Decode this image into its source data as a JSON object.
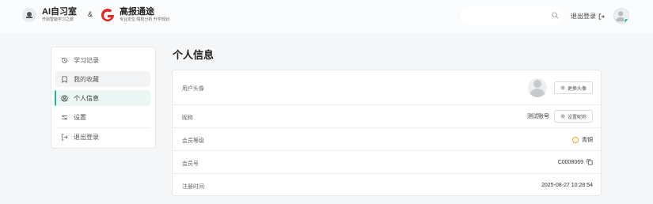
{
  "header": {
    "brand1_title": "AI自习室",
    "brand1_subtitle": "开启智能学习之旅",
    "amp": "&",
    "brand2_title": "高报通途",
    "brand2_subtitle": "专业定位 院校分析 升学规划",
    "logout_label": "退出登录"
  },
  "sidebar": {
    "items": [
      {
        "label": "学习记录",
        "icon": "history-icon"
      },
      {
        "label": "我的收藏",
        "icon": "bookmark-icon"
      },
      {
        "label": "个人信息",
        "icon": "user-circle-icon"
      },
      {
        "label": "设置",
        "icon": "settings-sliders-icon"
      },
      {
        "label": "退出登录",
        "icon": "logout-icon"
      }
    ]
  },
  "main": {
    "title": "个人信息",
    "rows": {
      "avatar": {
        "label": "用户头像",
        "button": "更换头像"
      },
      "nickname": {
        "label": "昵称",
        "value": "测试账号",
        "button": "设置昵称"
      },
      "level": {
        "label": "会员等级",
        "value": "青铜"
      },
      "member_id": {
        "label": "会员号",
        "value": "C0008069"
      },
      "registered": {
        "label": "注册时间",
        "value": "2025-08-27 10:28:54"
      }
    }
  },
  "colors": {
    "accent": "#22b8a3",
    "brand_red": "#e8251f",
    "bronze": "#f0a020"
  }
}
